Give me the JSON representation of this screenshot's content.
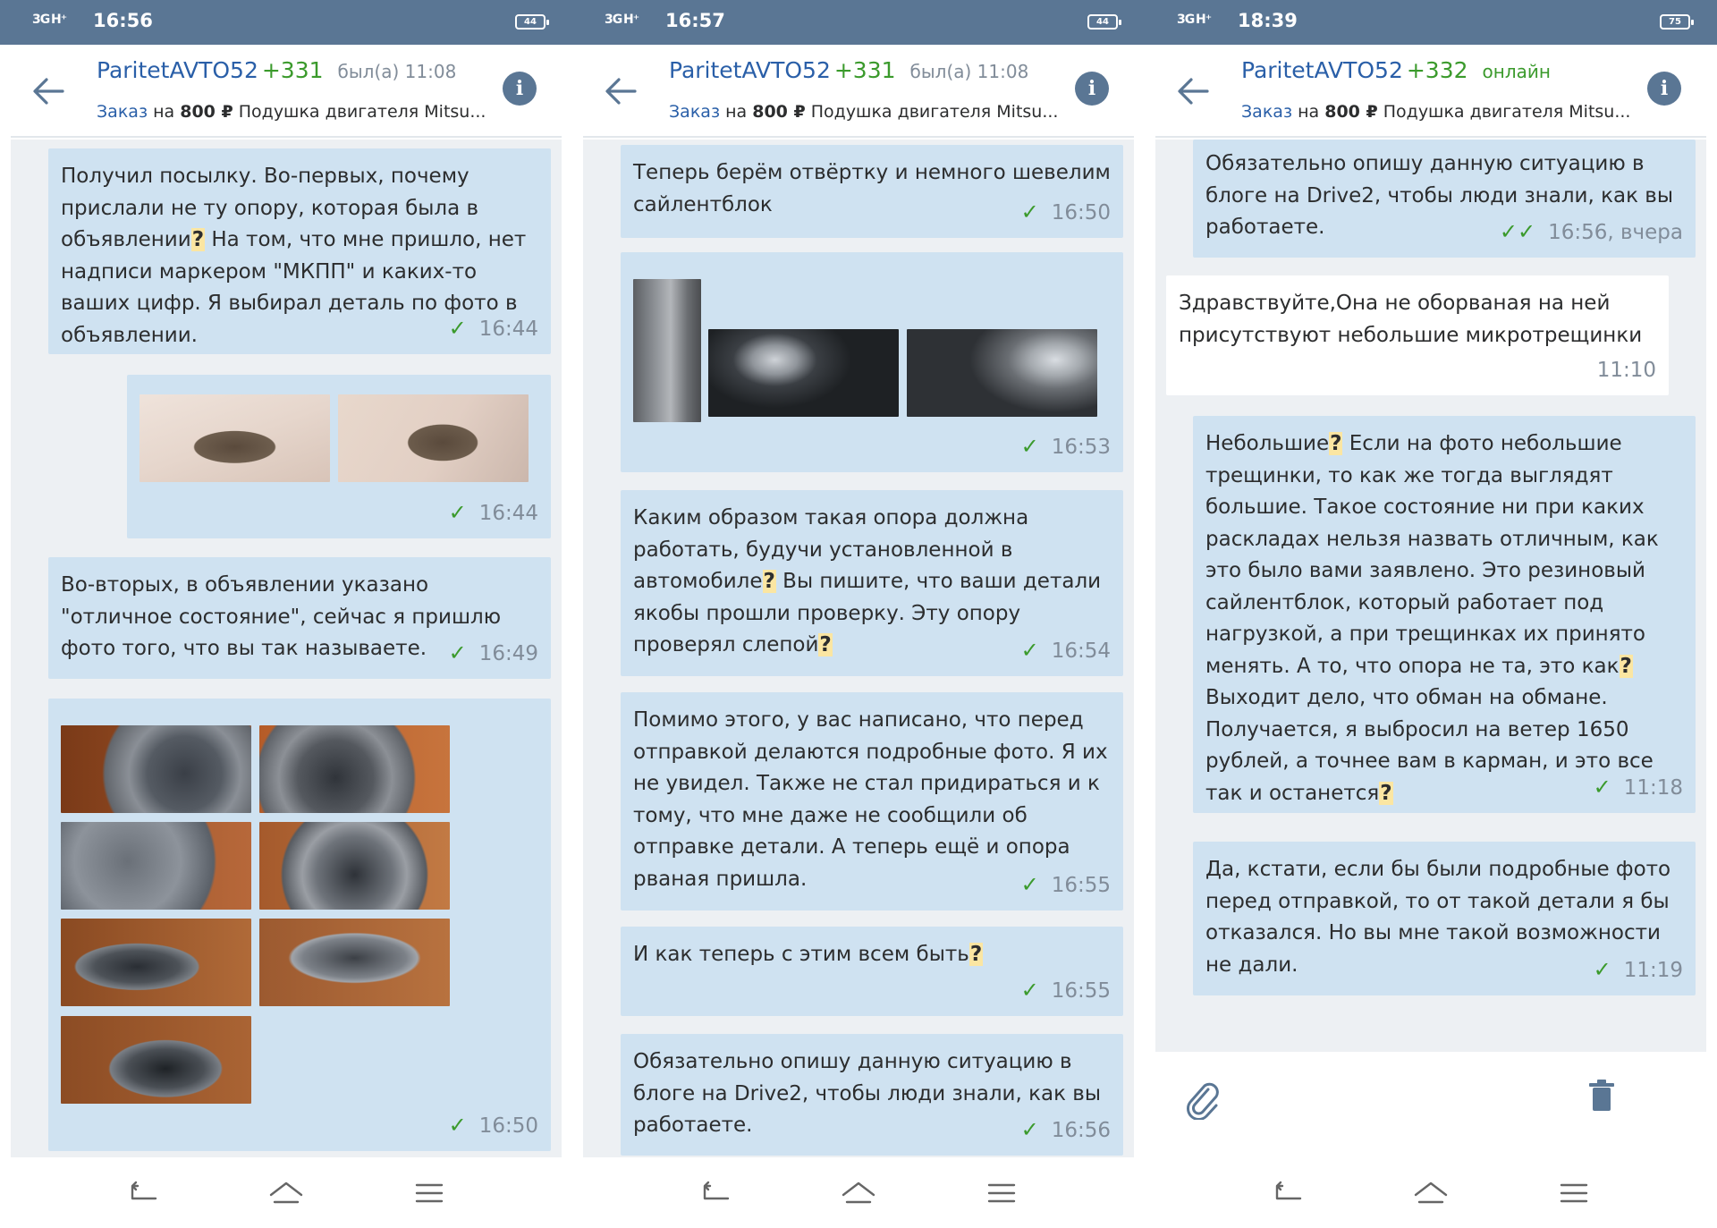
{
  "phones": [
    {
      "status": {
        "signal": "3G H⁺",
        "time": "16:56",
        "battery": "44"
      },
      "header": {
        "name": "ParitetAVTO52",
        "rating": "+331",
        "status": "был(а) 11:08",
        "order_link": "Заказ",
        "order_on": "на",
        "order_amount": "800 ₽",
        "order_item": "Подушка двигателя Mitsu..."
      },
      "messages": [
        {
          "parts": [
            "Получил посылку. Во-первых, почему прислали не ту опору, которая была в объявлении",
            "?",
            " На том, что мне пришло, нет надписи маркером \"МКПП\" и каких-то ваших цифр. Я выбирал деталь по фото в объявлении."
          ],
          "time": "16:44"
        },
        {
          "time": "16:44"
        },
        {
          "text": "Во-вторых, в объявлении указано \"отличное состояние\", сейчас я пришлю фото того, что вы так называете.",
          "time": "16:49"
        },
        {
          "time": "16:50"
        }
      ]
    },
    {
      "status": {
        "signal": "3G H⁺",
        "time": "16:57",
        "battery": "44"
      },
      "header": {
        "name": "ParitetAVTO52",
        "rating": "+331",
        "status": "был(а) 11:08",
        "order_link": "Заказ",
        "order_on": "на",
        "order_amount": "800 ₽",
        "order_item": "Подушка двигателя Mitsu..."
      },
      "messages": [
        {
          "text": "Теперь берём отвёртку и немного шевелим сайлентблок",
          "time": "16:50"
        },
        {
          "time": "16:53"
        },
        {
          "parts": [
            "Каким образом такая опора должна работать, будучи установленной в автомобиле",
            "?",
            " Вы пишите, что ваши детали якобы прошли проверку. Эту опору проверял слепой",
            "?",
            ""
          ],
          "time": "16:54"
        },
        {
          "text": "Помимо этого, у вас написано, что перед отправкой делаются подробные фото. Я их не увидел. Также не стал придираться и к тому, что мне даже не сообщили об отправке детали. А теперь ещё и опора рваная пришла.",
          "time": "16:55"
        },
        {
          "parts": [
            "И как теперь с этим всем быть",
            "?",
            ""
          ],
          "time": "16:55"
        },
        {
          "text": "Обязательно опишу данную ситуацию в блоге на Drive2, чтобы люди знали, как вы работаете.",
          "time": "16:56"
        }
      ]
    },
    {
      "status": {
        "signal": "3G H⁺",
        "time": "18:39",
        "battery": "75"
      },
      "header": {
        "name": "ParitetAVTO52",
        "rating": "+332",
        "status": "онлайн",
        "order_link": "Заказ",
        "order_on": "на",
        "order_amount": "800 ₽",
        "order_item": "Подушка двигателя Mitsu..."
      },
      "messages": [
        {
          "text": "Обязательно опишу данную ситуацию в блоге на Drive2, чтобы люди знали, как вы работаете.",
          "time": "16:56, вчера"
        },
        {
          "text": "Здравствуйте,Она не оборваная на ней присутствуют небольшие микротрещинки",
          "time": "11:10"
        },
        {
          "parts": [
            "Небольшие",
            "?",
            " Если на фото небольшие трещинки, то как же тогда выглядят большие. Такое состояние ни при каких раскладах нельзя назвать отличным, как это было вами заявлено. Это резиновый сайлентблок, который работает под нагрузкой, а при трещинках их принято менять. А то, что опора не та, это как",
            "?",
            " Выходит дело, что обман на обмане. Получается, я выбросил на ветер 1650 рублей, а точнее вам в карман, и это все так и останется",
            "?",
            ""
          ],
          "time": "11:18"
        },
        {
          "text": "Да, кстати, если бы были подробные фото перед отправкой, то от такой детали я бы отказался. Но вы мне такой возможности не дали.",
          "time": "11:19"
        }
      ]
    }
  ],
  "icons": {
    "back": "arrow-left-icon",
    "info": "info-icon",
    "check": "check-icon",
    "double_check": "double-check-icon",
    "attach": "paperclip-icon",
    "delete": "trash-icon",
    "nav_back": "nav-back-icon",
    "nav_home": "nav-home-icon",
    "nav_menu": "nav-menu-icon"
  },
  "colors": {
    "statusbar": "#5a7694",
    "outgoing_bubble": "#cfe2f1",
    "incoming_bubble": "#ffffff",
    "chat_bg": "#edf0f3",
    "link": "#2a5fa8",
    "rating": "#3b9a2c",
    "check": "#3b9a2c",
    "question_highlight": "#fbe6a2"
  }
}
